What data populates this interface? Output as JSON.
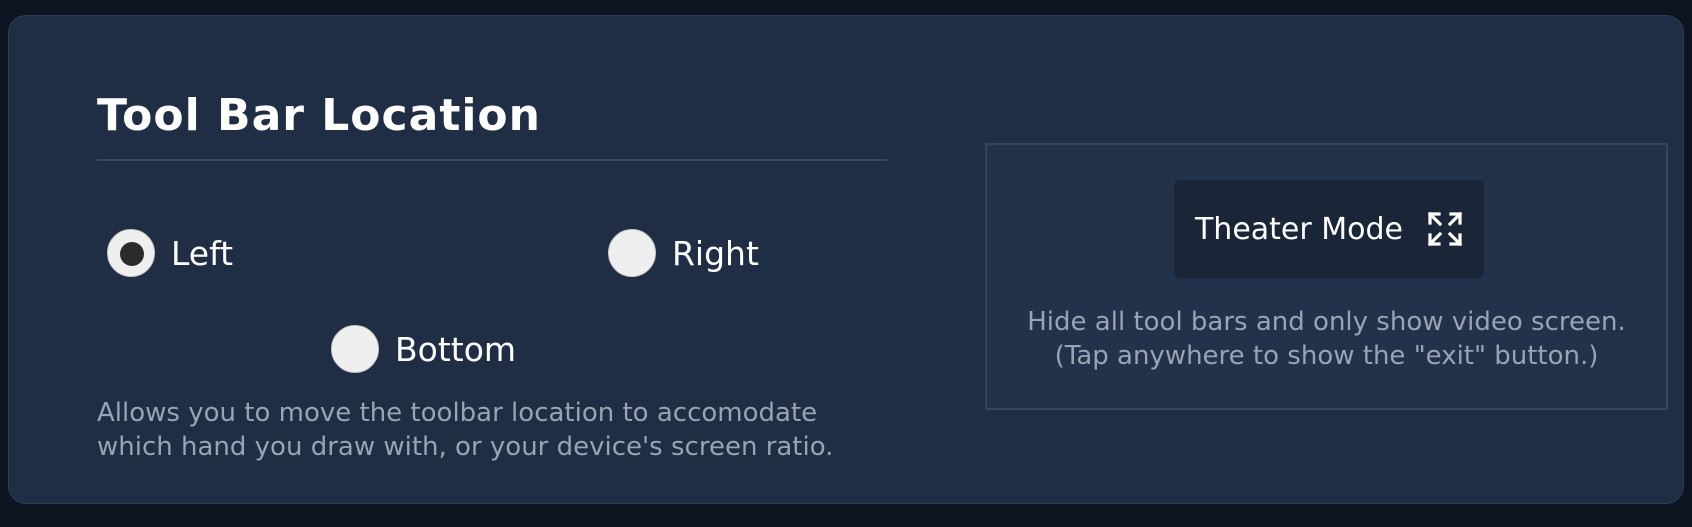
{
  "toolbar_location": {
    "title": "Tool Bar Location",
    "options": [
      {
        "label": "Left",
        "selected": true
      },
      {
        "label": "Right",
        "selected": false
      },
      {
        "label": "Bottom",
        "selected": false
      }
    ],
    "description_lines": [
      "Allows you to move the toolbar location to accomodate",
      "which hand you draw with, or your device's screen ratio."
    ]
  },
  "theater_mode": {
    "button_label": "Theater Mode",
    "button_icon": "expand-icon",
    "description_lines": [
      "Hide all tool bars and only show video screen.",
      "(Tap anywhere to show the \"exit\" button.)"
    ]
  },
  "colors": {
    "page_background": "#0d1520",
    "panel_background": "#1f2e45",
    "secondary_text": "#98a3b3",
    "radio_fill": "#efefef"
  }
}
